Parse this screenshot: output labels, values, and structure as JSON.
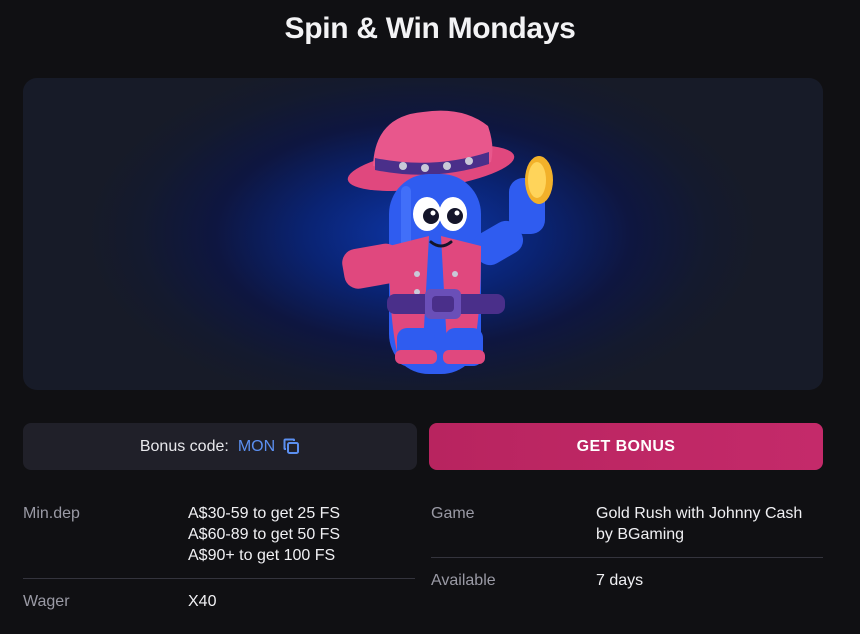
{
  "page": {
    "title": "Spin & Win Mondays"
  },
  "bonus": {
    "code_label": "Bonus code:",
    "code_value": "MON",
    "cta_label": "GET BONUS"
  },
  "details": {
    "min_dep": {
      "label": "Min.dep",
      "lines": [
        "A$30-59 to get 25 FS",
        "A$60-89 to get 50 FS",
        "A$90+ to get 100 FS"
      ]
    },
    "wager": {
      "label": "Wager",
      "value": "X40"
    },
    "game": {
      "label": "Game",
      "lines": [
        "Gold Rush with Johnny Cash",
        "by BGaming"
      ]
    },
    "available": {
      "label": "Available",
      "value": "7 days"
    }
  },
  "colors": {
    "background": "#101013",
    "accent": "#c42a6a",
    "code_link": "#5b8ff0",
    "panel": "#202029"
  },
  "icons": {
    "copy": "copy-icon"
  }
}
